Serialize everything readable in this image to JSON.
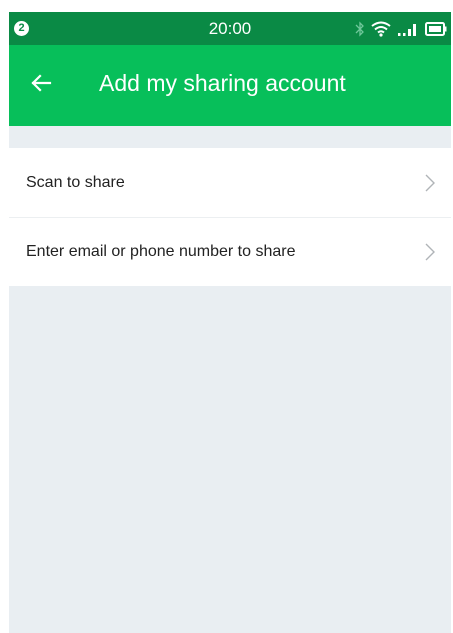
{
  "status_bar": {
    "notification_count": "2",
    "time": "20:00",
    "icons": [
      "bluetooth-icon",
      "wifi-icon",
      "signal-icon",
      "battery-icon"
    ]
  },
  "app_bar": {
    "title": "Add my sharing account",
    "back_icon": "arrow-left-icon"
  },
  "list": {
    "items": [
      {
        "label": "Scan to share",
        "icon": "chevron-right-icon"
      },
      {
        "label": "Enter email or phone number to share",
        "icon": "chevron-right-icon"
      }
    ]
  },
  "colors": {
    "status_bar": "#0a8a45",
    "app_bar": "#07bf5a",
    "background": "#e9eef2",
    "list_background": "#ffffff",
    "text": "#222222",
    "chevron": "#b0b4b8"
  }
}
